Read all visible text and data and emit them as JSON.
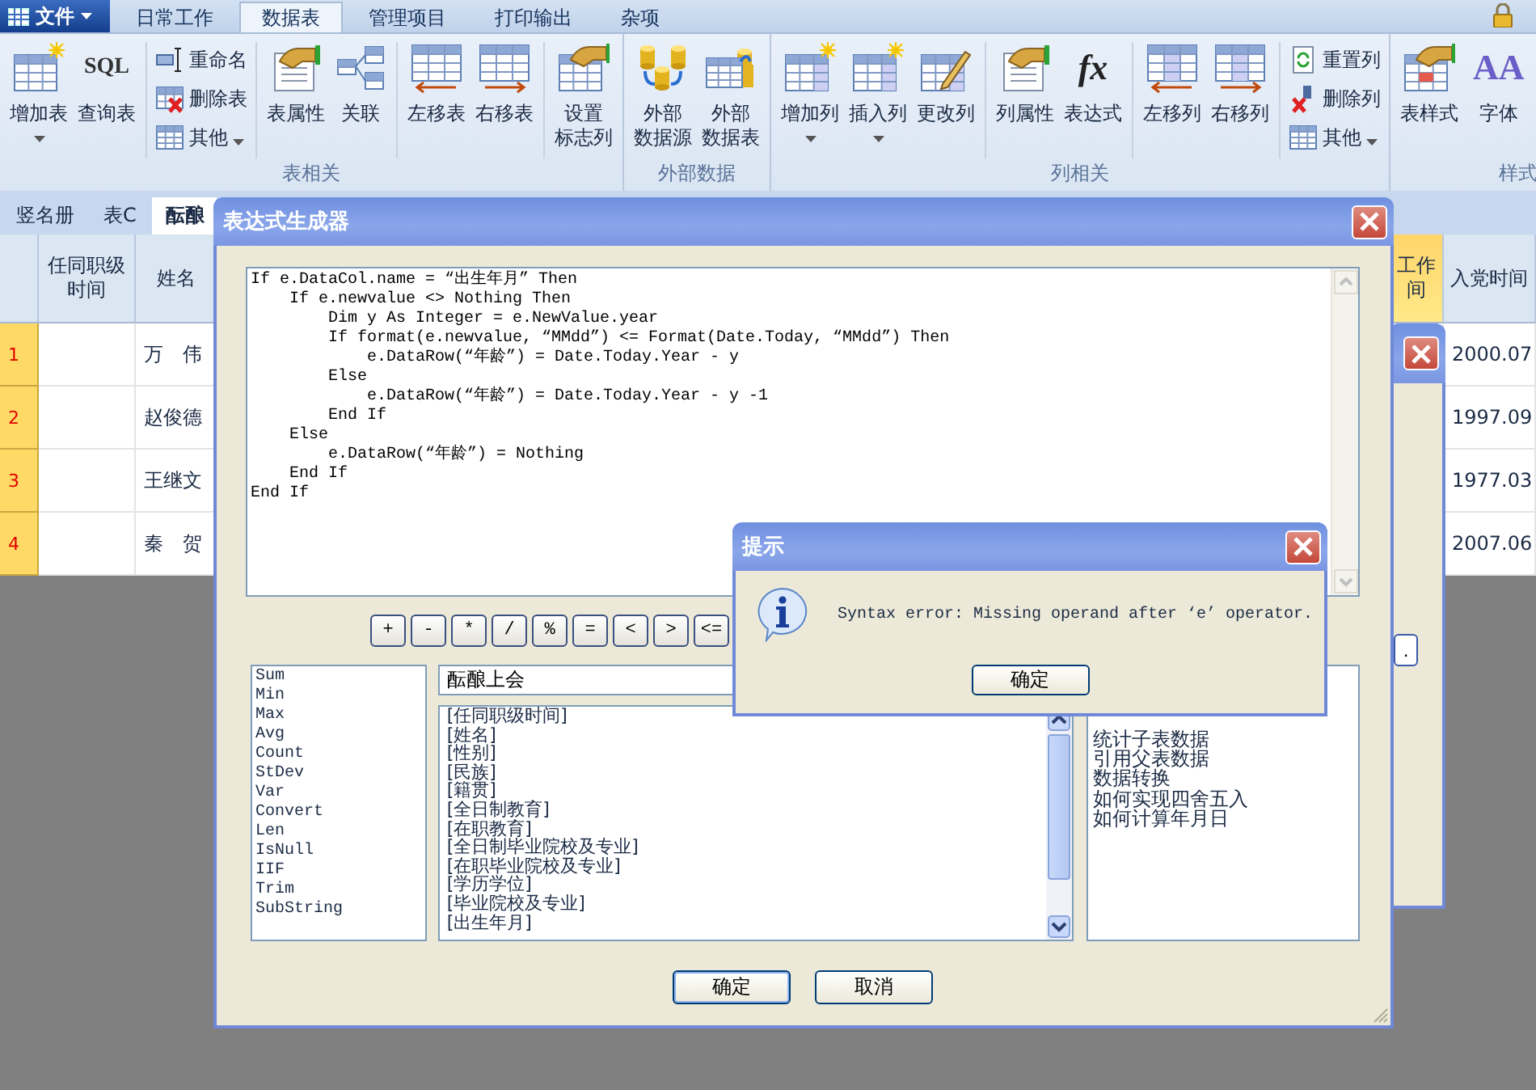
{
  "menu_bar": {
    "file_button": "文件",
    "tabs": [
      {
        "label": "日常工作",
        "selected": false
      },
      {
        "label": "数据表",
        "selected": true
      },
      {
        "label": "管理项目",
        "selected": false
      },
      {
        "label": "打印输出",
        "selected": false
      },
      {
        "label": "杂项",
        "selected": false
      }
    ]
  },
  "ribbon": {
    "groups": [
      {
        "label": "表相关",
        "clusters": [
          [
            {
              "kind": "large",
              "label": "增加表",
              "dropdown": true
            },
            {
              "kind": "large",
              "label": "查询表",
              "icon_text": "SQL",
              "dropdown": false
            }
          ],
          [
            {
              "kind": "small",
              "label": "重命名",
              "dropdown": false
            },
            {
              "kind": "small",
              "label": "删除表",
              "dropdown": false
            },
            {
              "kind": "small",
              "label": "其他",
              "dropdown": true
            }
          ],
          [
            {
              "kind": "large",
              "label": "表属性",
              "dropdown": false
            },
            {
              "kind": "large",
              "label": "关联",
              "dropdown": false
            }
          ],
          [
            {
              "kind": "large",
              "label": "左移表",
              "dropdown": false
            },
            {
              "kind": "large",
              "label": "右移表",
              "dropdown": false
            }
          ],
          [
            {
              "kind": "large_two_line",
              "label": "设置标志列",
              "dropdown": false
            }
          ]
        ]
      },
      {
        "label": "外部数据",
        "clusters": [
          [
            {
              "kind": "large_two_line",
              "label": "外部数据源",
              "dropdown": false
            },
            {
              "kind": "large_two_line",
              "label": "外部数据表",
              "dropdown": false
            }
          ]
        ]
      },
      {
        "label": "列相关",
        "clusters": [
          [
            {
              "kind": "large",
              "label": "增加列",
              "dropdown": true
            },
            {
              "kind": "large",
              "label": "插入列",
              "dropdown": true
            },
            {
              "kind": "large",
              "label": "更改列",
              "dropdown": false
            }
          ],
          [
            {
              "kind": "large",
              "label": "列属性",
              "dropdown": false
            },
            {
              "kind": "large",
              "label": "表达式",
              "icon_text": "fx",
              "dropdown": false
            }
          ],
          [
            {
              "kind": "large",
              "label": "左移列",
              "dropdown": false
            },
            {
              "kind": "large",
              "label": "右移列",
              "dropdown": false
            }
          ],
          [
            {
              "kind": "small",
              "label": "重置列",
              "dropdown": false
            },
            {
              "kind": "small",
              "label": "删除列",
              "dropdown": false
            },
            {
              "kind": "small",
              "label": "其他",
              "dropdown": true
            }
          ]
        ]
      },
      {
        "label": "样式",
        "clusters": [
          [
            {
              "kind": "large",
              "label": "表样式",
              "dropdown": false
            },
            {
              "kind": "large",
              "label": "字体",
              "icon_text": "AA",
              "dropdown": false
            }
          ]
        ]
      }
    ]
  },
  "sheet_tabs": [
    {
      "label": "竖名册",
      "selected": false
    },
    {
      "label": "表C",
      "selected": false
    },
    {
      "label": "酝酿",
      "selected": true
    }
  ],
  "table": {
    "columns": [
      {
        "label": "任同职级时间",
        "selected": false
      },
      {
        "label": "姓名",
        "selected": false
      },
      {
        "label": "工作间",
        "selected": true
      },
      {
        "label": "入党时间",
        "selected": false
      }
    ],
    "rows": [
      {
        "number": "1",
        "name": "万　伟",
        "date": "2000.07"
      },
      {
        "number": "2",
        "name": "赵俊德",
        "date": "1997.09"
      },
      {
        "number": "3",
        "name": "王继文",
        "date": "1977.03"
      },
      {
        "number": "4",
        "name": "秦　贺",
        "date": "2007.06"
      }
    ]
  },
  "behind_window": {
    "button": "."
  },
  "expression_dialog": {
    "title": "表达式生成器",
    "code": [
      "If e.DataCol.name = “出生年月” Then",
      "    If e.newvalue <> Nothing Then",
      "        Dim y As Integer = e.NewValue.year",
      "        If format(e.newvalue, “MMdd”) <= Format(Date.Today, “MMdd”) Then",
      "            e.DataRow(“年龄”) = Date.Today.Year - y",
      "        Else",
      "            e.DataRow(“年龄”) = Date.Today.Year - y -1",
      "        End If",
      "    Else",
      "        e.DataRow(“年龄”) = Nothing",
      "    End If",
      "End If"
    ],
    "operators": [
      "+",
      "-",
      "*",
      "/",
      "%",
      "=",
      "<",
      ">",
      "<="
    ],
    "functions": [
      "Sum",
      "Min",
      "Max",
      "Avg",
      "Count",
      "StDev",
      "Var",
      "Convert",
      "Len",
      "IsNull",
      "IIF",
      "Trim",
      "SubString"
    ],
    "table_name": "酝酿上会",
    "fields": [
      "[任同职级时间]",
      "[姓名]",
      "[性别]",
      "[民族]",
      "[籍贯]",
      "[全日制教育]",
      "[在职教育]",
      "[全日制毕业院校及专业]",
      "[在职毕业院校及专业]",
      "[学历学位]",
      "[毕业院校及专业]",
      "[出生年月]"
    ],
    "topics": [
      "统计子表数据",
      "引用父表数据",
      "数据转换",
      "如何实现四舍五入",
      "如何计算年月日"
    ],
    "buttons": [
      "确定",
      "取消"
    ]
  },
  "message_box": {
    "title": "提示",
    "message": "Syntax error: Missing operand after ‘e’ operator.",
    "button": "确定"
  }
}
